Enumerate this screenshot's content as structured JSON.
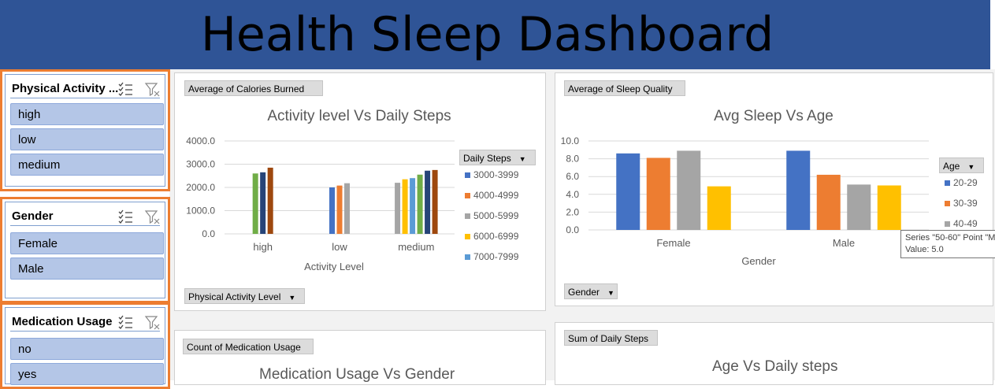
{
  "dashboard": {
    "title": "Health Sleep Dashboard"
  },
  "colors": {
    "banner": "#2f5496",
    "slicer_border": "#ed7d31",
    "slicer_item": "#b4c6e7",
    "s1": "#4472c4",
    "s2": "#ed7d31",
    "s3": "#a5a5a5",
    "s4": "#ffc000",
    "s5": "#5b9bd5",
    "s6": "#70ad47",
    "s7": "#264478",
    "s8": "#9e480e"
  },
  "slicers": {
    "activity": {
      "title": "Physical Activity ...",
      "items": [
        "high",
        "low",
        "medium"
      ]
    },
    "gender": {
      "title": "Gender",
      "items": [
        "Female",
        "Male"
      ]
    },
    "medication": {
      "title": "Medication Usage",
      "items": [
        "no",
        "yes"
      ]
    }
  },
  "charts": {
    "activity": {
      "value_button": "Average of Calories Burned",
      "axis_button": "Physical Activity Level",
      "legend_button": "Daily  Steps",
      "legend_items": [
        "3000-3999",
        "4000-4999",
        "5000-5999",
        "6000-6999",
        "7000-7999"
      ]
    },
    "sleep": {
      "value_button": "Average of Sleep Quality",
      "axis_button": "Gender",
      "legend_button": "Age",
      "legend_items": [
        "20-29",
        "30-39",
        "40-49"
      ],
      "tooltip_line1": "Series \"50-60\" Point \"M",
      "tooltip_line2": "Value: 5.0"
    },
    "medication": {
      "value_button": "Count of Medication Usage",
      "title": "Medication Usage Vs Gender"
    },
    "steps": {
      "value_button": "Sum of Daily  Steps",
      "title": "Age Vs Daily steps"
    }
  },
  "chart_data": [
    {
      "type": "bar",
      "title": "Activity level Vs Daily Steps",
      "xlabel": "Activity Level",
      "ylabel": "",
      "ylim": [
        0,
        4000
      ],
      "yticks": [
        "0.0",
        "1000.0",
        "2000.0",
        "3000.0",
        "4000.0"
      ],
      "categories": [
        "high",
        "low",
        "medium"
      ],
      "groups": [
        {
          "category": "high",
          "bars": [
            {
              "color": "#70ad47",
              "value": 2600
            },
            {
              "color": "#264478",
              "value": 2650
            },
            {
              "color": "#9e480e",
              "value": 2850
            }
          ]
        },
        {
          "category": "low",
          "bars": [
            {
              "color": "#4472c4",
              "value": 2000
            },
            {
              "color": "#ed7d31",
              "value": 2080
            },
            {
              "color": "#a5a5a5",
              "value": 2180
            }
          ]
        },
        {
          "category": "medium",
          "bars": [
            {
              "color": "#a5a5a5",
              "value": 2200
            },
            {
              "color": "#ffc000",
              "value": 2350
            },
            {
              "color": "#5b9bd5",
              "value": 2400
            },
            {
              "color": "#70ad47",
              "value": 2550
            },
            {
              "color": "#264478",
              "value": 2720
            },
            {
              "color": "#9e480e",
              "value": 2750
            }
          ]
        }
      ]
    },
    {
      "type": "bar",
      "title": "Avg Sleep Vs Age",
      "xlabel": "Gender",
      "ylabel": "",
      "ylim": [
        0,
        10
      ],
      "yticks": [
        "0.0",
        "2.0",
        "4.0",
        "6.0",
        "8.0",
        "10.0"
      ],
      "categories": [
        "Female",
        "Male"
      ],
      "groups": [
        {
          "category": "Female",
          "bars": [
            {
              "color": "#4472c4",
              "value": 8.6
            },
            {
              "color": "#ed7d31",
              "value": 8.1
            },
            {
              "color": "#a5a5a5",
              "value": 8.9
            },
            {
              "color": "#ffc000",
              "value": 4.9
            }
          ]
        },
        {
          "category": "Male",
          "bars": [
            {
              "color": "#4472c4",
              "value": 8.9
            },
            {
              "color": "#ed7d31",
              "value": 6.2
            },
            {
              "color": "#a5a5a5",
              "value": 5.1
            },
            {
              "color": "#ffc000",
              "value": 5.0
            }
          ]
        }
      ]
    }
  ]
}
